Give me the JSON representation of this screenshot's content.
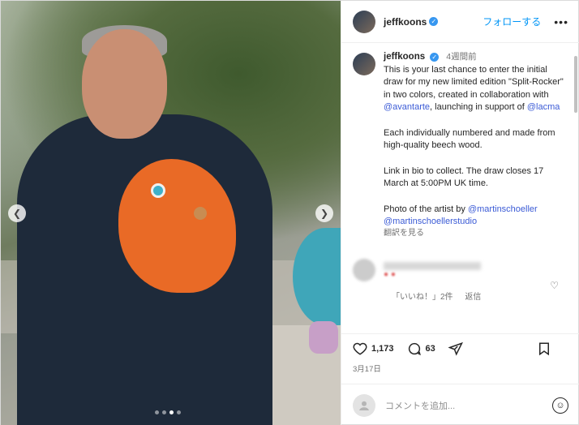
{
  "post": {
    "username": "jeffkoons",
    "follow_label": "フォローする",
    "more_label": "•••",
    "time_ago": "4週間前",
    "caption_paragraphs": [
      [
        "This is your last chance to enter the initial draw for my new limited edition \"Split-Rocker\" in two colors, created in collaboration with ",
        "@avantarte",
        ", launching in support of ",
        "@lacma"
      ],
      [
        "Each individually numbered and made from high-quality beech wood."
      ],
      [
        "Link in bio to collect. The draw closes 17 March at 5:00PM UK time."
      ]
    ],
    "photo_credit_prefix": "Photo of the artist by ",
    "photo_credit_1": "@martinschoeller",
    "photo_credit_2": "@martinschoellerstudio",
    "translate_label": "翻訳を見る",
    "comment_meta": {
      "likes": "「いいね！」2件",
      "reply": "返信"
    },
    "likes_count": "1,173",
    "comments_count": "63",
    "date": "3月17日",
    "add_comment_placeholder": "コメントを追加...",
    "carousel": {
      "slides": 4,
      "active": 3
    }
  },
  "icons": {
    "prev": "chevron-left-icon",
    "next": "chevron-right-icon",
    "like": "heart-icon",
    "comment": "comment-bubble-icon",
    "share": "paper-plane-icon",
    "save": "bookmark-icon",
    "emoji": "smiley-icon"
  },
  "colors": {
    "accent": "#0095f6",
    "verified": "#3797f0",
    "link": "#3b5bd6"
  }
}
